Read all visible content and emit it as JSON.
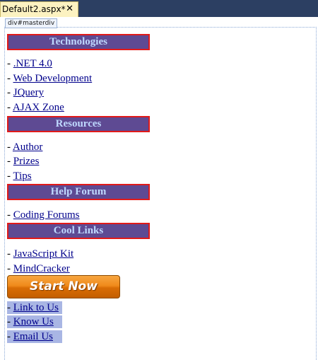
{
  "tab": {
    "title": "Default2.aspx*",
    "close_glyph": "✕"
  },
  "designer": {
    "selector_tag": "div#masterdiv"
  },
  "sections": [
    {
      "header": "Technologies",
      "links": [
        ".NET 4.0",
        "Web Development",
        "JQuery",
        "AJAX Zone"
      ]
    },
    {
      "header": "Resources",
      "links": [
        "Author",
        "Prizes",
        "Tips"
      ]
    },
    {
      "header": "Help Forum",
      "links": [
        "Coding Forums"
      ]
    },
    {
      "header": "Cool Links",
      "links": [
        "JavaScript Kit",
        "MindCracker"
      ]
    }
  ],
  "start_button": {
    "label": "Start Now"
  },
  "footer_links": [
    "Link to Us",
    "Know Us",
    "Email Us"
  ],
  "link_prefix": "- ",
  "colors": {
    "header_bg": "#5e4a93",
    "header_border": "#e01a1a",
    "header_text": "#bfd9ff",
    "link": "#00008b",
    "button_orange": "#f08a1b",
    "highlight": "#a9b6e4",
    "tab_bg": "#fcf2c1",
    "tabstrip_bg": "#2c3f62"
  }
}
